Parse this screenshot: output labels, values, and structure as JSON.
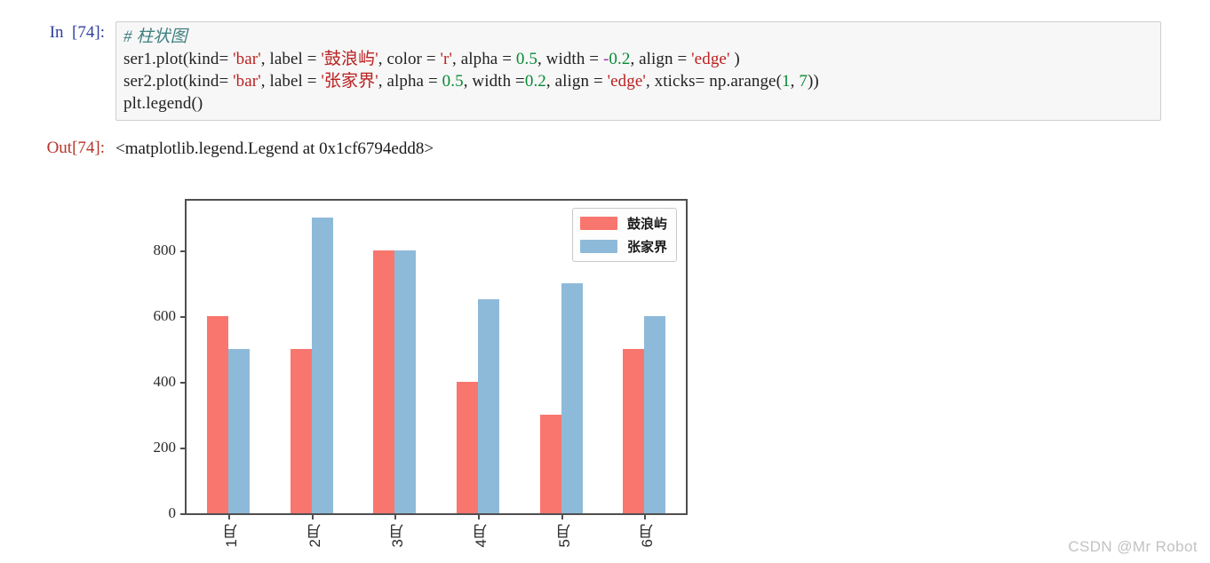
{
  "notebook": {
    "input_prompt": "In  [74]:",
    "output_prompt": "Out[74]:",
    "output_text": "<matplotlib.legend.Legend at 0x1cf6794edd8>",
    "code_lines": [
      {
        "id": "line1",
        "tokens": [
          {
            "t": "comment",
            "v": "# 柱状图"
          }
        ]
      },
      {
        "id": "line2",
        "tokens": [
          {
            "t": "name",
            "v": "ser1.plot(kind= "
          },
          {
            "t": "str",
            "v": "'bar'"
          },
          {
            "t": "name",
            "v": ", label = "
          },
          {
            "t": "str",
            "v": "'鼓浪屿'"
          },
          {
            "t": "name",
            "v": ", color = "
          },
          {
            "t": "str",
            "v": "'r'"
          },
          {
            "t": "name",
            "v": ", alpha = "
          },
          {
            "t": "num",
            "v": "0.5"
          },
          {
            "t": "name",
            "v": ", width = "
          },
          {
            "t": "op",
            "v": "-"
          },
          {
            "t": "num",
            "v": "0.2"
          },
          {
            "t": "name",
            "v": ", align = "
          },
          {
            "t": "str",
            "v": "'edge'"
          },
          {
            "t": "name",
            "v": " )"
          }
        ]
      },
      {
        "id": "line3",
        "tokens": [
          {
            "t": "name",
            "v": "ser2.plot(kind= "
          },
          {
            "t": "str",
            "v": "'bar'"
          },
          {
            "t": "name",
            "v": ", label = "
          },
          {
            "t": "str",
            "v": "'张家界'"
          },
          {
            "t": "name",
            "v": ", alpha = "
          },
          {
            "t": "num",
            "v": "0.5"
          },
          {
            "t": "name",
            "v": ", width ="
          },
          {
            "t": "num",
            "v": "0.2"
          },
          {
            "t": "name",
            "v": ", align = "
          },
          {
            "t": "str",
            "v": "'edge'"
          },
          {
            "t": "name",
            "v": ", xticks= np.arange("
          },
          {
            "t": "num",
            "v": "1"
          },
          {
            "t": "name",
            "v": ", "
          },
          {
            "t": "num",
            "v": "7"
          },
          {
            "t": "name",
            "v": "))"
          }
        ]
      },
      {
        "id": "line4",
        "tokens": [
          {
            "t": "name",
            "v": "plt.legend()"
          }
        ]
      }
    ]
  },
  "watermark": "CSDN @Mr Robot",
  "chart_data": {
    "type": "bar",
    "title": "",
    "xlabel": "",
    "ylabel": "",
    "categories": [
      "1月",
      "2月",
      "3月",
      "4月",
      "5月",
      "6月"
    ],
    "series": [
      {
        "name": "鼓浪屿",
        "color": "#F8766D",
        "values": [
          600,
          500,
          800,
          400,
          300,
          500
        ]
      },
      {
        "name": "张家界",
        "color": "#8EBAD9",
        "values": [
          500,
          900,
          800,
          650,
          700,
          600
        ]
      }
    ],
    "ylim": [
      0,
      950
    ],
    "yticks": [
      0,
      200,
      400,
      600,
      800
    ],
    "ytick_labels": [
      "0",
      "200",
      "400",
      "600",
      "800"
    ],
    "xtick_labels": [
      "1月",
      "2月",
      "3月",
      "4月",
      "5月",
      "6月"
    ],
    "xtick_rotation": 90,
    "grid": false,
    "legend_position": "upper right",
    "bar_width": 0.2,
    "alpha": 0.5
  }
}
